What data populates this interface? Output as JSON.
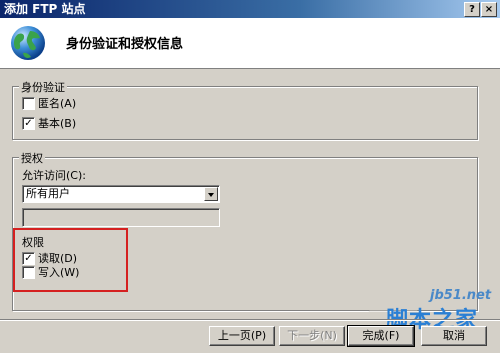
{
  "window": {
    "title": "添加 FTP 站点",
    "help_glyph": "?",
    "close_glyph": "×"
  },
  "header": {
    "title": "身份验证和授权信息",
    "icon": "globe-icon"
  },
  "authentication": {
    "legend": "身份验证",
    "options": [
      {
        "label": "匿名(A)",
        "checked": false
      },
      {
        "label": "基本(B)",
        "checked": true
      }
    ]
  },
  "authorization": {
    "legend": "授权",
    "allow_access_label": "允许访问(C):",
    "allow_access_value": "所有用户",
    "extra_field_value": "",
    "permissions_label": "权限",
    "permissions": [
      {
        "label": "读取(D)",
        "checked": true
      },
      {
        "label": "写入(W)",
        "checked": false
      }
    ]
  },
  "buttons": {
    "previous": "上一页(P)",
    "next": "下一步(N)",
    "finish": "完成(F)",
    "cancel": "取消"
  },
  "watermark": {
    "url": "jb51.net",
    "brand": "脚本之家"
  },
  "colors": {
    "title_bar": "#0a246a",
    "highlight_box": "#d52020",
    "watermark": "#2a7fd4"
  }
}
